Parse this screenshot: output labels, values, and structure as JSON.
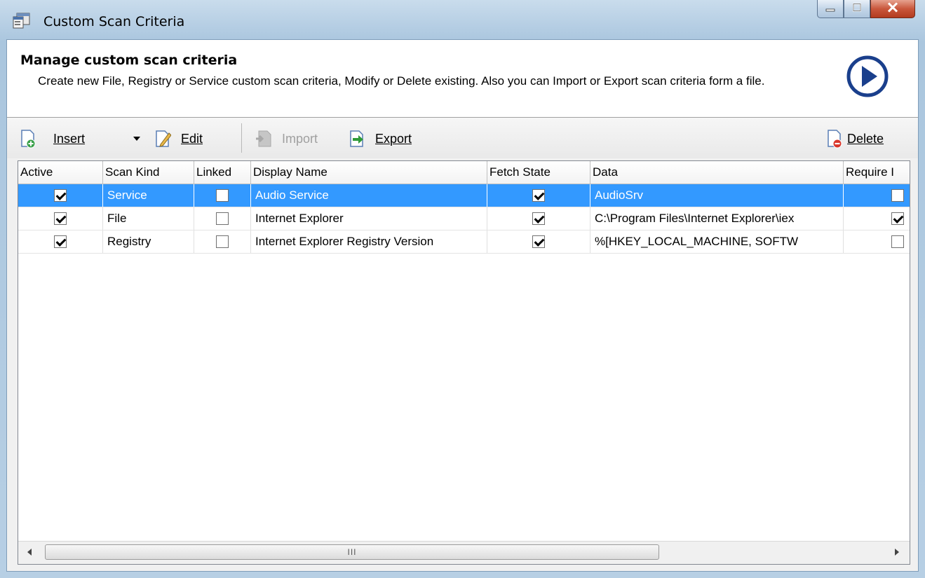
{
  "window": {
    "title": "Custom Scan Criteria"
  },
  "header": {
    "title": "Manage custom scan criteria",
    "description": "Create new File, Registry or Service custom scan criteria, Modify or Delete existing. Also you can Import or Export scan criteria form a file."
  },
  "toolbar": {
    "insert_label": "Insert",
    "edit_label": "Edit",
    "import_label": "Import",
    "export_label": "Export",
    "delete_label": "Delete"
  },
  "grid": {
    "columns": [
      "Active",
      "Scan Kind",
      "Linked",
      "Display Name",
      "Fetch State",
      "Data",
      "Require I"
    ],
    "rows": [
      {
        "active": true,
        "kind": "Service",
        "linked": false,
        "name": "Audio Service",
        "fetch": true,
        "data": "AudioSrv",
        "require": false,
        "selected": true
      },
      {
        "active": true,
        "kind": "File",
        "linked": false,
        "name": "Internet Explorer",
        "fetch": true,
        "data": "C:\\Program Files\\Internet Explorer\\iex",
        "require": true,
        "selected": false
      },
      {
        "active": true,
        "kind": "Registry",
        "linked": false,
        "name": "Internet Explorer Registry Version",
        "fetch": true,
        "data": "%[HKEY_LOCAL_MACHINE, SOFTW",
        "require": false,
        "selected": false
      }
    ]
  },
  "scrollbar": {
    "grip": "III"
  },
  "colors": {
    "selection": "#3399ff",
    "accent": "#1a4a9c"
  }
}
